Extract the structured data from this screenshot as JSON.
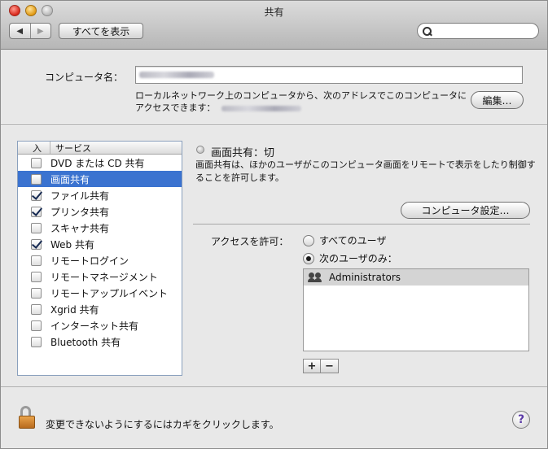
{
  "window": {
    "title": "共有"
  },
  "toolbar": {
    "back_glyph": "◀",
    "forward_glyph": "▶",
    "show_all_label": "すべてを表示",
    "search": {
      "value": "",
      "placeholder": ""
    }
  },
  "computer_name": {
    "label": "コンピュータ名：",
    "address_line1": "ローカルネットワーク上のコンピュータから、次のアドレスでこのコンピュータに",
    "address_line2_prefix": "アクセスできます：",
    "edit_button": "編集…"
  },
  "services": {
    "header_on": "入",
    "header_service": "サービス",
    "items": [
      {
        "label": "DVD または CD 共有",
        "checked": false,
        "selected": false
      },
      {
        "label": "画面共有",
        "checked": false,
        "selected": true
      },
      {
        "label": "ファイル共有",
        "checked": true,
        "selected": false
      },
      {
        "label": "プリンタ共有",
        "checked": true,
        "selected": false
      },
      {
        "label": "スキャナ共有",
        "checked": false,
        "selected": false
      },
      {
        "label": "Web 共有",
        "checked": true,
        "selected": false
      },
      {
        "label": "リモートログイン",
        "checked": false,
        "selected": false
      },
      {
        "label": "リモートマネージメント",
        "checked": false,
        "selected": false
      },
      {
        "label": "リモートアップルイベント",
        "checked": false,
        "selected": false
      },
      {
        "label": "Xgrid 共有",
        "checked": false,
        "selected": false
      },
      {
        "label": "インターネット共有",
        "checked": false,
        "selected": false
      },
      {
        "label": "Bluetooth 共有",
        "checked": false,
        "selected": false
      }
    ]
  },
  "detail": {
    "status": "画面共有：切",
    "description": "画面共有は、ほかのユーザがこのコンピュータ画面をリモートで表示をしたり制御することを許可します。",
    "computer_settings_button": "コンピュータ設定…",
    "access_label": "アクセスを許可：",
    "access_all": "すべてのユーザ",
    "access_only": "次のユーザのみ：",
    "access_selected": "only",
    "users": [
      "Administrators"
    ],
    "add_glyph": "+",
    "remove_glyph": "−"
  },
  "footer": {
    "lock_text": "変更できないようにするにはカギをクリックします。",
    "help_glyph": "?"
  },
  "colors": {
    "selection": "#3b73d0",
    "help_glyph": "#5b3aa6",
    "lock_body": "#d48a35"
  }
}
